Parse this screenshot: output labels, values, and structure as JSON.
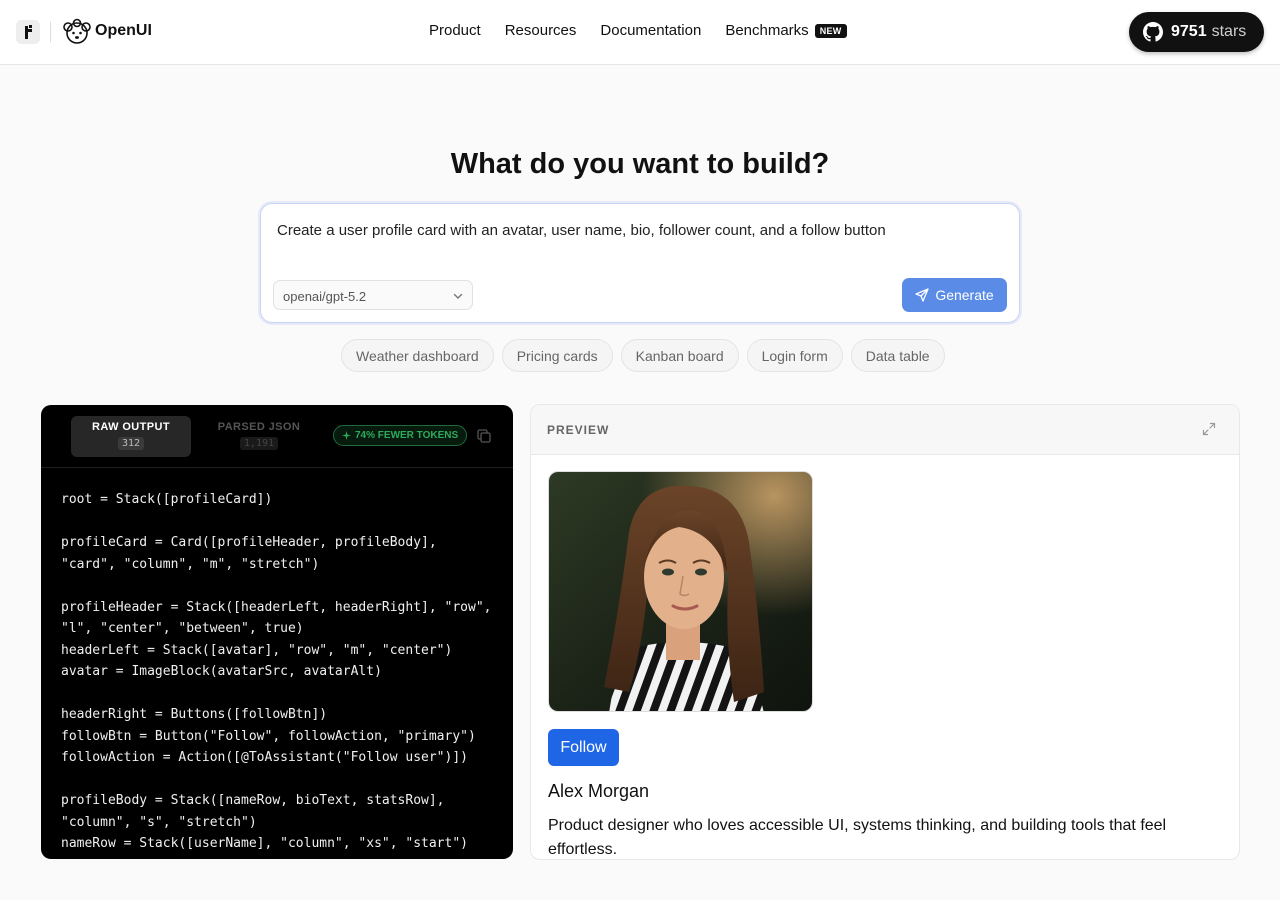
{
  "nav": {
    "brand": "OpenUI",
    "links": [
      "Product",
      "Resources",
      "Documentation",
      "Benchmarks"
    ],
    "new_badge": "NEW",
    "stars_count": "9751",
    "stars_label": "stars"
  },
  "hero": {
    "title": "What do you want to build?",
    "prompt": "Create a user profile card with an avatar, user name, bio, follower count, and a follow button",
    "model": "openai/gpt-5.2",
    "generate_label": "Generate"
  },
  "chips": [
    "Weather dashboard",
    "Pricing cards",
    "Kanban board",
    "Login form",
    "Data table"
  ],
  "code_panel": {
    "tab_raw": "RAW OUTPUT",
    "tab_raw_count": "312",
    "tab_json": "PARSED JSON",
    "tab_json_count": "1,191",
    "tokens_badge": "74% FEWER TOKENS",
    "code": "root = Stack([profileCard])\n\nprofileCard = Card([profileHeader, profileBody],\n\"card\", \"column\", \"m\", \"stretch\")\n\nprofileHeader = Stack([headerLeft, headerRight], \"row\",\n\"l\", \"center\", \"between\", true)\nheaderLeft = Stack([avatar], \"row\", \"m\", \"center\")\navatar = ImageBlock(avatarSrc, avatarAlt)\n\nheaderRight = Buttons([followBtn])\nfollowBtn = Button(\"Follow\", followAction, \"primary\")\nfollowAction = Action([@ToAssistant(\"Follow user\")])\n\nprofileBody = Stack([nameRow, bioText, statsRow],\n\"column\", \"s\", \"stretch\")\nnameRow = Stack([userName], \"column\", \"xs\", \"start\")\nuserName = TextContent(\"Alex Morgan\", \"large-heavy\")"
  },
  "preview": {
    "title": "PREVIEW",
    "follow_label": "Follow",
    "user_name": "Alex Morgan",
    "bio": "Product designer who loves accessible UI, systems thinking, and building tools that feel effortless."
  },
  "colors": {
    "accent": "#5a8be6",
    "follow": "#1e66e6",
    "token_green": "#2eaa5c"
  }
}
